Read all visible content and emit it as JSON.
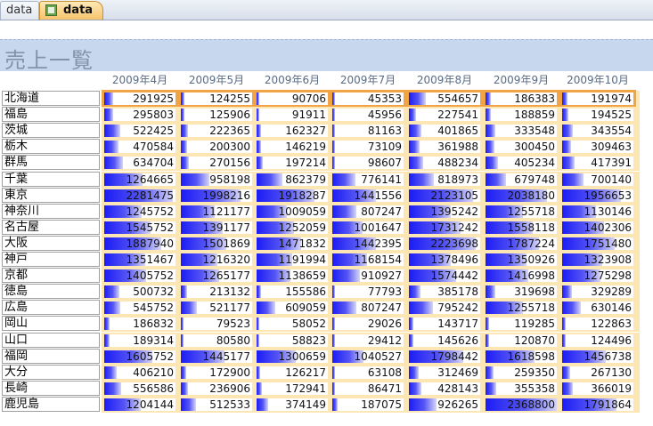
{
  "tabs": [
    "data",
    "data"
  ],
  "title": "売上一覧",
  "months": [
    "2009年4月",
    "2009年5月",
    "2009年6月",
    "2009年7月",
    "2009年8月",
    "2009年9月",
    "2009年10月"
  ],
  "max_value": 2368800,
  "rows": [
    {
      "name": "北海道",
      "values": [
        291925,
        124255,
        90706,
        45353,
        554657,
        186383,
        191974
      ]
    },
    {
      "name": "福島",
      "values": [
        295803,
        125906,
        91911,
        45956,
        227541,
        188859,
        194525
      ]
    },
    {
      "name": "茨城",
      "values": [
        522425,
        222365,
        162327,
        81163,
        401865,
        333548,
        343554
      ]
    },
    {
      "name": "栃木",
      "values": [
        470584,
        200300,
        146219,
        73109,
        361988,
        300450,
        309463
      ]
    },
    {
      "name": "群馬",
      "values": [
        634704,
        270156,
        197214,
        98607,
        488234,
        405234,
        417391
      ]
    },
    {
      "name": "千葉",
      "values": [
        1264665,
        958198,
        862379,
        776141,
        818973,
        679748,
        700140
      ]
    },
    {
      "name": "東京",
      "values": [
        2281475,
        1998216,
        1918287,
        1441556,
        2123105,
        2038180,
        1956653
      ]
    },
    {
      "name": "神奈川",
      "values": [
        1245752,
        1121177,
        1009059,
        807247,
        1395242,
        1255718,
        1130146
      ]
    },
    {
      "name": "名古屋",
      "values": [
        1545752,
        1391177,
        1252059,
        1001647,
        1731242,
        1558118,
        1402306
      ]
    },
    {
      "name": "大阪",
      "values": [
        1887940,
        1501869,
        1471832,
        1442395,
        2223698,
        1787224,
        1751480
      ]
    },
    {
      "name": "神戸",
      "values": [
        1351467,
        1216320,
        1191994,
        1168154,
        1378496,
        1350926,
        1323908
      ]
    },
    {
      "name": "京都",
      "values": [
        1405752,
        1265177,
        1138659,
        910927,
        1574442,
        1416998,
        1275298
      ]
    },
    {
      "name": "徳島",
      "values": [
        500732,
        213132,
        155586,
        77793,
        385178,
        319698,
        329289
      ]
    },
    {
      "name": "広島",
      "values": [
        545752,
        521177,
        609059,
        807247,
        795242,
        1255718,
        630146
      ]
    },
    {
      "name": "岡山",
      "values": [
        186832,
        79523,
        58052,
        29026,
        143717,
        119285,
        122863
      ]
    },
    {
      "name": "山口",
      "values": [
        189314,
        80580,
        58823,
        29412,
        145626,
        120870,
        124496
      ]
    },
    {
      "name": "福岡",
      "values": [
        1605752,
        1445177,
        1300659,
        1040527,
        1798442,
        1618598,
        1456738
      ]
    },
    {
      "name": "大分",
      "values": [
        406210,
        172900,
        126217,
        63108,
        312469,
        259350,
        267130
      ]
    },
    {
      "name": "長崎",
      "values": [
        556586,
        236906,
        172941,
        86471,
        428143,
        355358,
        366019
      ]
    },
    {
      "name": "鹿児島",
      "values": [
        1204144,
        512533,
        374149,
        187075,
        926265,
        2368800,
        1791864
      ]
    }
  ],
  "highlighted_row": "北海道"
}
